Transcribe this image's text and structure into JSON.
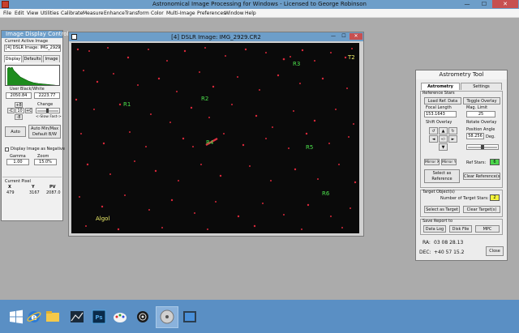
{
  "app": {
    "title": "Astronomical Image Processing for Windows - Licensed to George Robinson",
    "minimize": "—",
    "maximize": "☐",
    "close": "✕"
  },
  "menu": [
    "File",
    "Edit",
    "View",
    "Utilities",
    "Calibrate",
    "Measure",
    "Enhance",
    "Transform",
    "Color",
    "Multi-Image",
    "Preferences",
    "Window",
    "Help"
  ],
  "image_display_control": {
    "title": "Image Display Control",
    "current_active_image_label": "Current Active Image",
    "current_active_image": "[4] DSLR Image: IMG_2929",
    "tabs": [
      "Display",
      "Defaults",
      "Image"
    ],
    "user_black_white_label": "User Black/White",
    "black_value": "2050.84",
    "white_value": "2223.77",
    "change_label": "Change",
    "step_value": "10",
    "plus8": "+8",
    "minus8": "-8",
    "minus_c": "-C",
    "plus_c": "+C",
    "slow_fast": "<-Slow Fast->",
    "auto_label": "Auto",
    "auto_minmax_label": "Auto Min/Max",
    "default_bw_label": "Default B/W",
    "display_negative_label": "Display Image as Negative",
    "gamma_label": "Gamma",
    "gamma_value": "1.00",
    "zoom_label": "Zoom",
    "zoom_value": "15.0%",
    "current_pixel_label": "Current Pixel",
    "pixel_headers": [
      "X",
      "Y",
      "PV"
    ],
    "pixel_values": [
      "479",
      "3167",
      "2087.0"
    ]
  },
  "dslr_window": {
    "title": "[4] DSLR Image: IMG_2929.CR2",
    "labels": [
      {
        "text": "R3",
        "color": "#4ce04c"
      },
      {
        "text": "T2",
        "color": "#f0f06a"
      },
      {
        "text": "R1",
        "color": "#4ce04c"
      },
      {
        "text": "R2",
        "color": "#4ce04c"
      },
      {
        "text": "R4",
        "color": "#4ce04c"
      },
      {
        "text": "R5",
        "color": "#4ce04c"
      },
      {
        "text": "R6",
        "color": "#4ce04c"
      },
      {
        "text": "Algol",
        "color": "#f0f06a"
      }
    ]
  },
  "astrometry": {
    "title": "Astrometry Tool",
    "tabs": [
      "Astrometry",
      "Settings"
    ],
    "reference_stars_label": "Reference Stars",
    "load_ref_data": "Load Ref. Data",
    "toggle_overlay": "Toggle Overlay",
    "focal_length_label": "Focal Length",
    "focal_length_value": "153.1643",
    "mag_limit_label": "Mag. Limit",
    "mag_limit_value": "25",
    "shift_overlay_label": "Shift Overlay",
    "rotate_overlay_label": "Rotate Overlay",
    "position_angle_label": "Position Angle",
    "position_angle_value": "58.256",
    "deg_label": "Deg.",
    "mirror_x": "Mirror X",
    "mirror_y": "Mirror Y",
    "ref_stars_label": "Ref Stars:",
    "ref_stars_value": "6",
    "select_as_reference": "Select as Reference",
    "clear_references": "Clear Reference(s)",
    "target_objects_label": "Target Object(s)",
    "number_of_target_stars_label": "Number of Target Stars:",
    "number_of_target_stars_value": "2",
    "select_as_target": "Select as Target",
    "clear_targets": "Clear Target(s)",
    "save_report_label": "Save Report to",
    "data_log": "Data Log",
    "disk_file": "Disk File",
    "mpc": "MPC",
    "ra_label": "RA:",
    "ra_value": "03 08 28.13",
    "dec_label": "DEC:",
    "dec_value": "+40 57 15.2",
    "close": "Close",
    "arrow_up": "▲",
    "arrow_down": "▼",
    "arrow_left": "◄",
    "arrow_right": "►",
    "center": "+/-",
    "rot_left": "↺",
    "rot_right": "↻"
  },
  "colors": {
    "titlebar": "#6d9ec9",
    "workspace": "#ababab",
    "taskbar": "#5a8fc4",
    "star_marker": "#d8283a",
    "reference_label": "#4ce04c",
    "target_label": "#f0f06a"
  },
  "taskbar_icons": [
    "windows-start-icon",
    "internet-explorer-icon",
    "file-explorer-icon",
    "spectrum-icon",
    "photoshop-icon",
    "paint-icon",
    "aip4win-icon",
    "dvd-icon",
    "media-icon"
  ]
}
